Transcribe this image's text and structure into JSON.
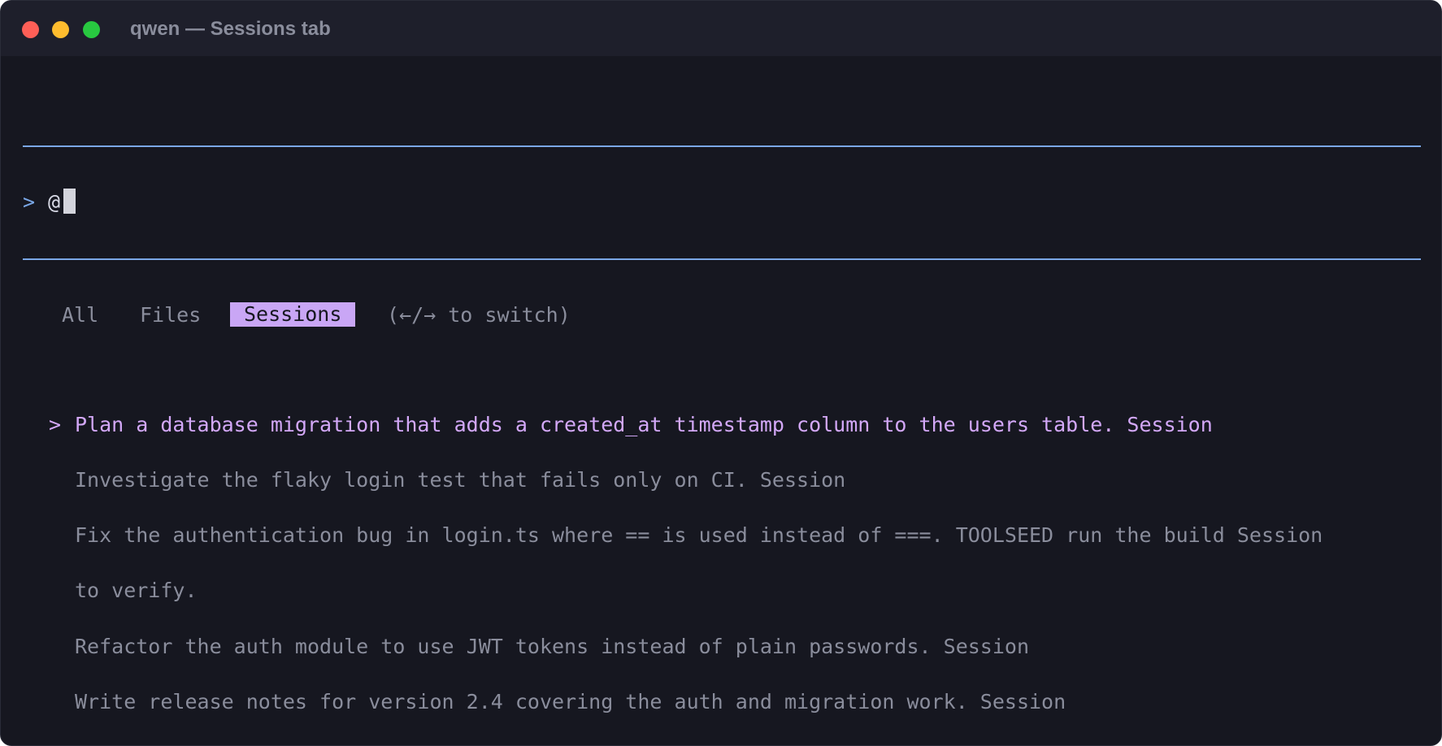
{
  "window": {
    "title": "qwen — Sessions tab"
  },
  "prompt": {
    "caret": ">",
    "value": "@"
  },
  "tabs": {
    "items": [
      "All",
      "Files",
      "Sessions"
    ],
    "active": "Sessions",
    "hint": "(←/→ to switch)"
  },
  "results": {
    "selected_marker": ">",
    "items": [
      "Plan a database migration that adds a created_at timestamp column to the users table. Session",
      "Investigate the flaky login test that fails only on CI. Session",
      "Fix the authentication bug in login.ts where == is used instead of ===. TOOLSEED run the build Session",
      "to verify.",
      "Refactor the auth module to use JWT tokens instead of plain passwords. Session",
      "Write release notes for version 2.4 covering the auth and migration work. Session"
    ]
  },
  "colors": {
    "background": "#161720",
    "accent_blue": "#7aa7e6",
    "accent_purple": "#c9a6f5",
    "muted_text": "#8a8d9c"
  }
}
